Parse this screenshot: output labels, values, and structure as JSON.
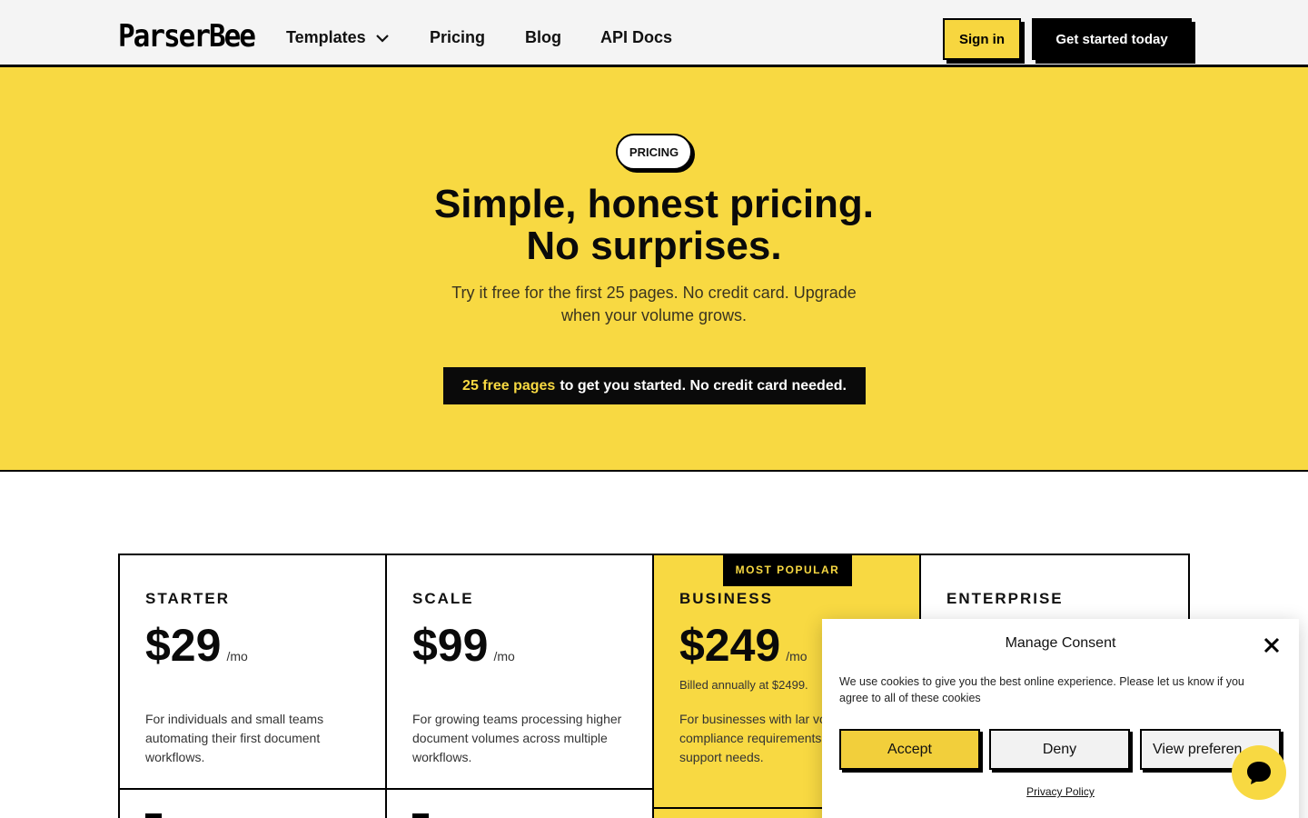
{
  "header": {
    "logo": "ParserBee",
    "nav": [
      {
        "label": "Templates"
      },
      {
        "label": "Pricing"
      },
      {
        "label": "Blog"
      },
      {
        "label": "API Docs"
      }
    ],
    "sign_in": "Sign in",
    "get_started": "Get started today"
  },
  "hero": {
    "badge": "PRICING",
    "title_line1": "Simple, honest pricing.",
    "title_line2": "No surprises.",
    "subtitle_line1": "Try it free for the first 25 pages. No credit card. Upgrade",
    "subtitle_line2": "when your volume grows.",
    "free_highlight": "25 free pages",
    "free_rest": "to get you started. No credit card needed."
  },
  "plans": [
    {
      "name": "STARTER",
      "price": "$29",
      "per": "/mo",
      "billed": "",
      "description": "For individuals and small teams automating their first document workflows."
    },
    {
      "name": "SCALE",
      "price": "$99",
      "per": "/mo",
      "billed": "",
      "description": "For growing teams processing higher document volumes across multiple workflows."
    },
    {
      "name": "BUSINESS",
      "price": "$249",
      "per": "/mo",
      "billed": "Billed annually at $2499.",
      "description": "For businesses with lar volumes, compliance requirements, and hand support needs.",
      "tag": "MOST POPULAR"
    },
    {
      "name": "ENTERPRISE",
      "price": "",
      "per": "",
      "billed": "",
      "description": ""
    }
  ],
  "consent": {
    "title": "Manage Consent",
    "text": "We use cookies to give you the best online experience. Please let us know if you agree to all of these cookies",
    "accept": "Accept",
    "deny": "Deny",
    "view": "View preferen",
    "privacy": "Privacy Policy"
  },
  "colors": {
    "brand_yellow": "#f8d942",
    "black": "#0a0a0a"
  },
  "icons": [
    "chevron-down-icon",
    "close-icon",
    "chat-icon"
  ]
}
